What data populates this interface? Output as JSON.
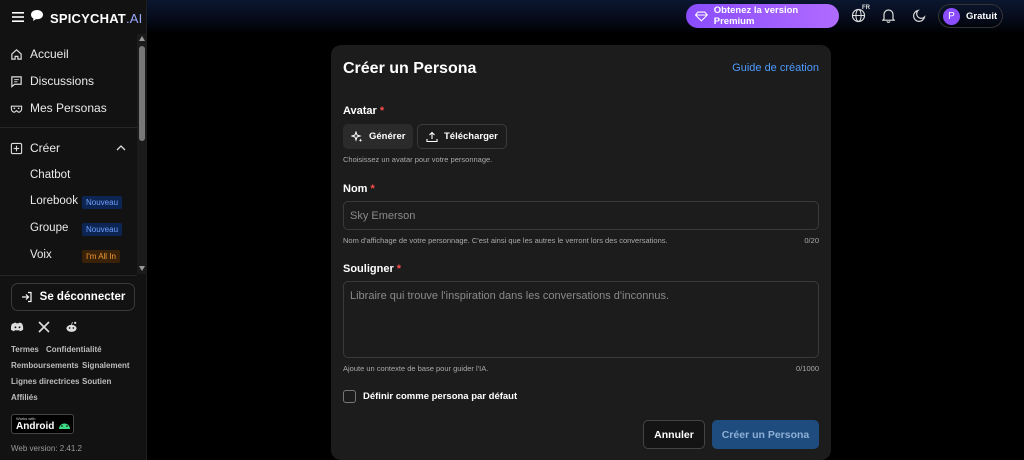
{
  "app": {
    "logo_main": "SPICYCHAT",
    "logo_suffix": ".AI"
  },
  "sidebar": {
    "nav": [
      {
        "label": "Accueil"
      },
      {
        "label": "Discussions"
      },
      {
        "label": "Mes Personas"
      }
    ],
    "create_label": "Créer",
    "create_items": [
      {
        "label": "Chatbot"
      },
      {
        "label": "Lorebook",
        "tag": "Nouveau"
      },
      {
        "label": "Groupe",
        "tag": "Nouveau"
      },
      {
        "label": "Voix",
        "tag": "I'm All In"
      }
    ],
    "logout_label": "Se déconnecter",
    "footer_links": [
      "Termes",
      "Confidentialité",
      "Remboursements",
      "Signalement",
      "Lignes directrices",
      "Soutien",
      "Affiliés"
    ],
    "android_badge_small": "Works with",
    "android_badge": "Android",
    "version": "Web version: 2.41.2"
  },
  "header": {
    "premium_label": "Obtenez la version Premium",
    "language": "FR",
    "user_initial": "P",
    "user_plan": "Gratuit"
  },
  "form": {
    "title": "Créer un Persona",
    "guide_link": "Guide de création",
    "avatar_label": "Avatar",
    "required_mark": "*",
    "generate_label": "Générer",
    "upload_label": "Télécharger",
    "avatar_hint": "Choisissez un avatar pour votre personnage.",
    "name_label": "Nom",
    "name_placeholder": "Sky Emerson",
    "name_hint": "Nom d'affichage de votre personnage. C'est ainsi que les autres le verront lors des conversations.",
    "name_count": "0/20",
    "highlight_label": "Souligner",
    "highlight_placeholder": "Libraire qui trouve l'inspiration dans les conversations d'inconnus.",
    "highlight_hint": "Ajoute un contexte de base pour guider l'IA.",
    "highlight_count": "0/1000",
    "default_label": "Définir comme persona par défaut",
    "cancel_label": "Annuler",
    "create_label": "Créer un Persona"
  },
  "colors": {
    "accent": "#4d9bff",
    "premium": "#8a4dff",
    "required": "#ff4d4d",
    "create_button": "#1f4c7f"
  }
}
